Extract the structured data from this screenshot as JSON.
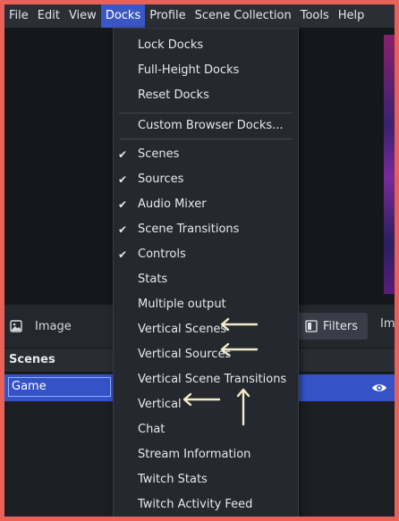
{
  "menubar": {
    "items": [
      "File",
      "Edit",
      "View",
      "Docks",
      "Profile",
      "Scene Collection",
      "Tools",
      "Help"
    ],
    "active": "Docks"
  },
  "docks_menu": {
    "lock_docks": "Lock Docks",
    "full_height_docks": "Full-Height Docks",
    "reset_docks": "Reset Docks",
    "custom_browser_docks": "Custom Browser Docks...",
    "scenes": "Scenes",
    "sources": "Sources",
    "audio_mixer": "Audio Mixer",
    "scene_transitions": "Scene Transitions",
    "controls": "Controls",
    "stats": "Stats",
    "multiple_output": "Multiple output",
    "vertical_scenes": "Vertical Scenes",
    "vertical_sources": "Vertical Sources",
    "vertical_scene_transitions": "Vertical Scene Transitions",
    "vertical": "Vertical",
    "chat": "Chat",
    "stream_information": "Stream Information",
    "twitch_stats": "Twitch Stats",
    "twitch_activity_feed": "Twitch Activity Feed",
    "check_glyph": "✔"
  },
  "toolbar": {
    "image_label": "Image",
    "filters_label": "Filters",
    "more_label": "Im"
  },
  "scenes": {
    "title": "Scenes",
    "items": [
      "Game"
    ]
  },
  "colors": {
    "border": "#e8625a",
    "menu_highlight": "#3b57c4",
    "selection": "#3552c6",
    "arrow": "#f3ecc8"
  }
}
